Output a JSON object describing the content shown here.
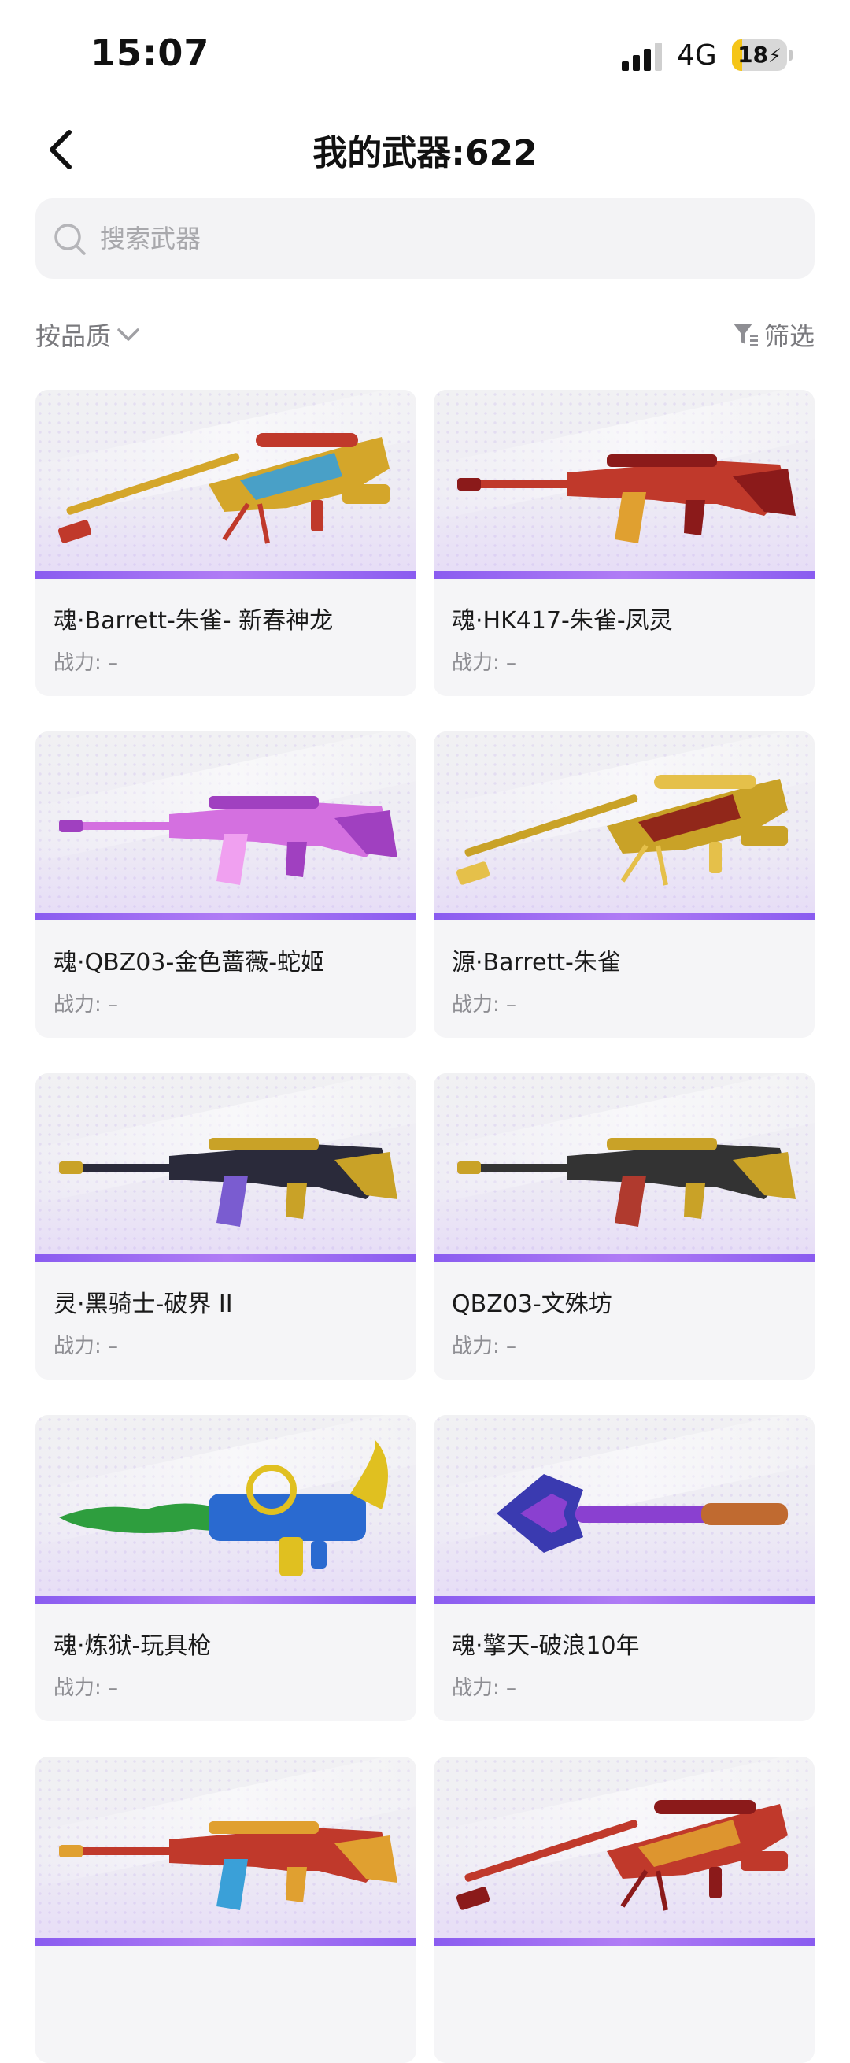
{
  "status_bar": {
    "time": "15:07",
    "network": "4G",
    "battery": "18",
    "battery_level": 0.18,
    "battery_charging": true
  },
  "header": {
    "title": "我的武器:622",
    "back_icon": "chevron-left-icon"
  },
  "search": {
    "placeholder": "搜索武器",
    "value": ""
  },
  "controls": {
    "sort_label": "按品质",
    "filter_label": "筛选"
  },
  "weapons": [
    {
      "name": "魂·Barrett-朱雀- 新春神龙",
      "power_label": "战力:",
      "power_value": "–",
      "colors": [
        "#d4a62a",
        "#3aa0d8",
        "#c0392b"
      ],
      "kind": "sniper"
    },
    {
      "name": "魂·HK417-朱雀-凤灵",
      "power_label": "战力:",
      "power_value": "–",
      "colors": [
        "#c0392b",
        "#e0a030",
        "#8b1a1a"
      ],
      "kind": "rifle"
    },
    {
      "name": "魂·QBZ03-金色蔷薇-蛇姬",
      "power_label": "战力:",
      "power_value": "–",
      "colors": [
        "#d470e0",
        "#f0a0f0",
        "#a040c0"
      ],
      "kind": "rifle"
    },
    {
      "name": "源·Barrett-朱雀",
      "power_label": "战力:",
      "power_value": "–",
      "colors": [
        "#c9a227",
        "#8b1a1a",
        "#e5c04a"
      ],
      "kind": "sniper"
    },
    {
      "name": "灵·黑骑士-破界 II",
      "power_label": "战力:",
      "power_value": "–",
      "colors": [
        "#2a2a3a",
        "#7a5cd0",
        "#c9a227"
      ],
      "kind": "rifle"
    },
    {
      "name": "QBZ03-文殊坊",
      "power_label": "战力:",
      "power_value": "–",
      "colors": [
        "#333333",
        "#b03a2e",
        "#c9a227"
      ],
      "kind": "rifle"
    },
    {
      "name": "魂·炼狱-玩具枪",
      "power_label": "战力:",
      "power_value": "–",
      "colors": [
        "#2e9e3e",
        "#2a6ad0",
        "#e0c020"
      ],
      "kind": "heavy"
    },
    {
      "name": "魂·擎天-破浪10年",
      "power_label": "战力:",
      "power_value": "–",
      "colors": [
        "#3a3ab0",
        "#8a40d0",
        "#c06a30"
      ],
      "kind": "spear"
    },
    {
      "name": "",
      "power_label": "",
      "power_value": "",
      "colors": [
        "#c0392b",
        "#3aa0d8",
        "#e0a030"
      ],
      "kind": "rifle"
    },
    {
      "name": "",
      "power_label": "",
      "power_value": "",
      "colors": [
        "#c0392b",
        "#e0a030",
        "#8b1a1a"
      ],
      "kind": "sniper"
    }
  ]
}
